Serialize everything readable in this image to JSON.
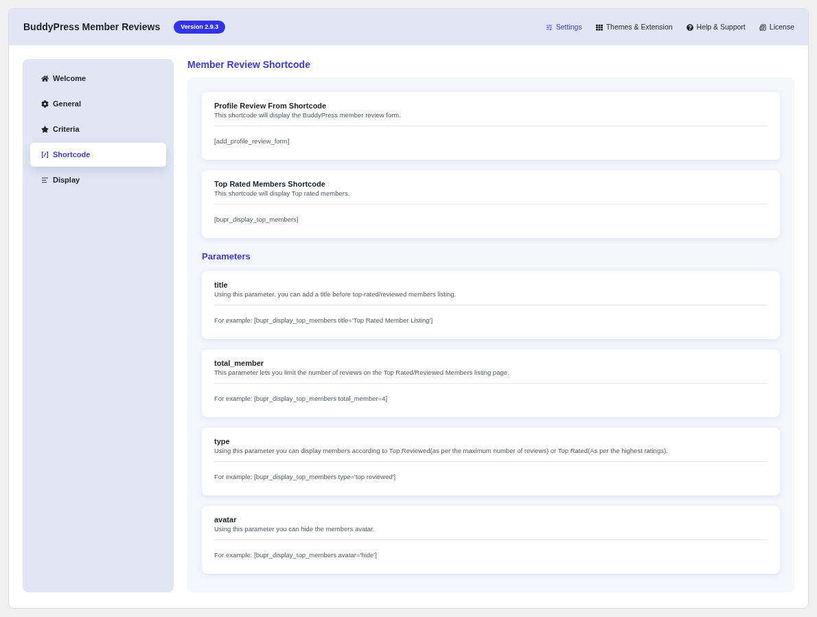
{
  "header": {
    "title": "BuddyPress Member Reviews",
    "version": "Version 2.9.3",
    "nav": [
      {
        "label": "Settings",
        "selected": true
      },
      {
        "label": "Themes & Extension",
        "selected": false
      },
      {
        "label": "Help & Support",
        "selected": false
      },
      {
        "label": "License",
        "selected": false
      }
    ]
  },
  "sidebar": {
    "items": [
      {
        "label": "Welcome",
        "selected": false
      },
      {
        "label": "General",
        "selected": false
      },
      {
        "label": "Criteria",
        "selected": false
      },
      {
        "label": "Shortcode",
        "selected": true
      },
      {
        "label": "Display",
        "selected": false
      }
    ]
  },
  "main": {
    "title": "Member Review Shortcode",
    "shortcodes": [
      {
        "title": "Profile Review From Shortcode",
        "description": "This shortcode will display the BuddyPress member review form.",
        "code": "[add_profile_review_form]"
      },
      {
        "title": "Top Rated Members Shortcode",
        "description": "This shortcode will display Top rated members.",
        "code": "[bupr_display_top_members]"
      }
    ],
    "parameters_title": "Parameters",
    "parameters": [
      {
        "title": "title",
        "description": "Using this parameter. you can add a title before top-rated/reviewed members listing.",
        "code": "For example: [bupr_display_top_members title='Top Rated Member Listing']"
      },
      {
        "title": "total_member",
        "description": "This parameter lets you limit the number of reviews on the Top Rated/Reviewed Members listing page.",
        "code": "For example: [bupr_display_top_members total_member=4]"
      },
      {
        "title": "type",
        "description": "Using this parameter you can display members according to Top Reviewed(as per the maximum number of reviews) or Top Rated(As per the highest ratings).",
        "code": "For example: [bupr_display_top_members type='top reviewed']"
      },
      {
        "title": "avatar",
        "description": "Using this parameter you can hide the members avatar.",
        "code": "For example: [bupr_display_top_members avatar='hide']"
      }
    ]
  }
}
